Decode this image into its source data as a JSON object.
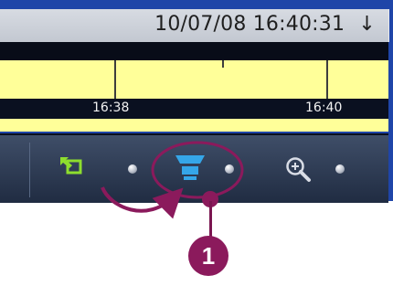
{
  "header": {
    "timestamp": "10/07/08 16:40:31",
    "sort_arrow": "↓"
  },
  "timeline": {
    "labels": [
      "16:38",
      "16:40"
    ]
  },
  "toolbar": {
    "buttons": [
      {
        "icon": "export-frame-icon",
        "accent": "#8ede2e"
      },
      {
        "icon": "camera-icon",
        "accent": "#35a6e8"
      },
      {
        "icon": "zoom-in-icon",
        "accent": "#d9dde6"
      }
    ]
  },
  "callout": {
    "number": "1",
    "color": "#8b1a5c"
  }
}
